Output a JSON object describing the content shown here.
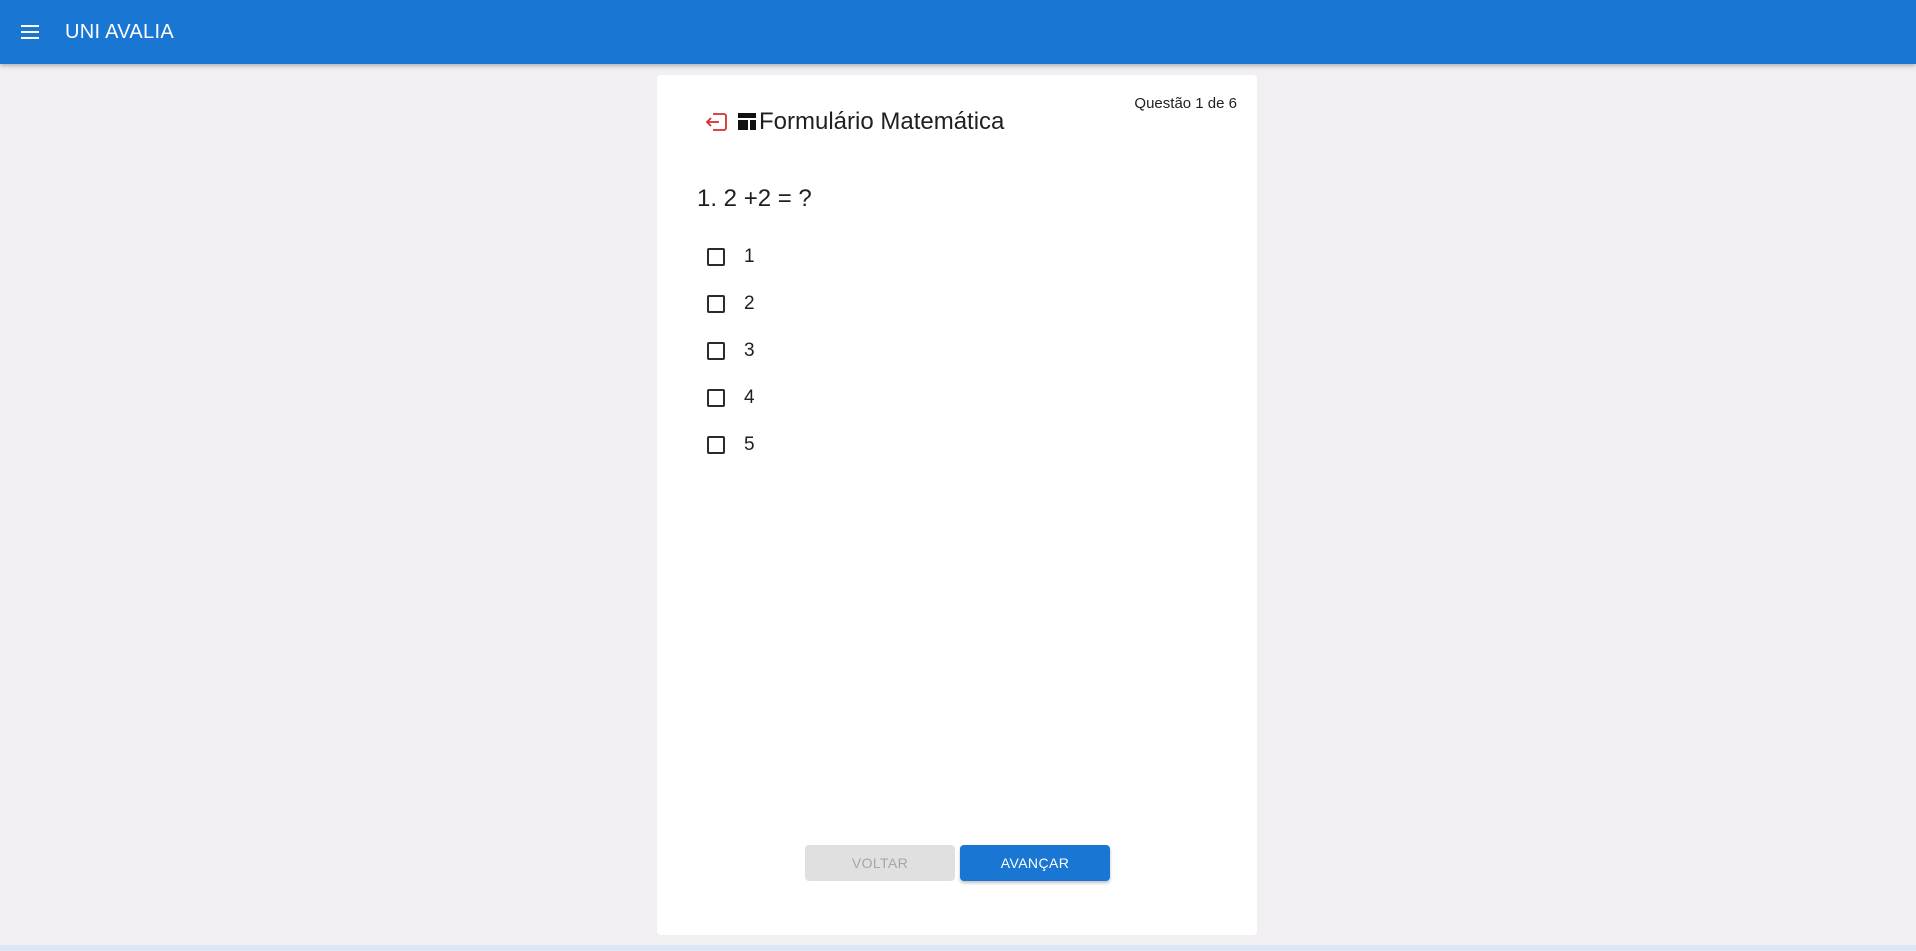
{
  "app_bar": {
    "title": "UNI AVALIA",
    "menu_icon": "menu-icon",
    "color": "#1976d2"
  },
  "form": {
    "exit_icon": "exit-icon",
    "form_icon": "form-icon",
    "title": "Formulário Matemática",
    "counter": "Questão 1 de 6"
  },
  "question": {
    "text": "1. 2 +2 = ?",
    "options": [
      {
        "label": "1",
        "checked": false
      },
      {
        "label": "2",
        "checked": false
      },
      {
        "label": "3",
        "checked": false
      },
      {
        "label": "4",
        "checked": false
      },
      {
        "label": "5",
        "checked": false
      }
    ]
  },
  "actions": {
    "back_label": "VOLTAR",
    "back_disabled": true,
    "next_label": "AVANÇAR"
  },
  "colors": {
    "background": "#f1eff2",
    "accent": "#1976d2",
    "exit_icon": "#d32f2f"
  }
}
